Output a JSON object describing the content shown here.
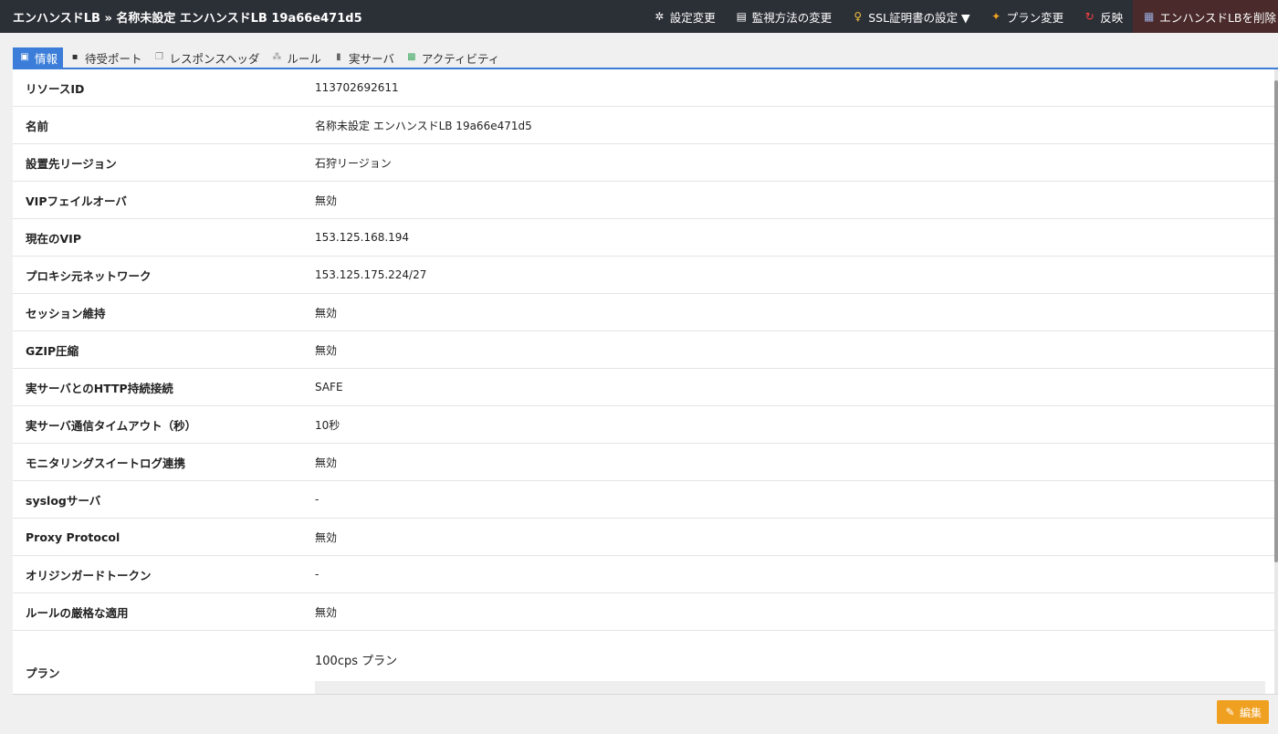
{
  "header": {
    "title": "エンハンスドLB » 名称未設定 エンハンスドLB 19a66e471d5",
    "actions": [
      {
        "label": "設定変更",
        "icon": "gear-icon"
      },
      {
        "label": "監視方法の変更",
        "icon": "monitor-icon"
      },
      {
        "label": "SSL証明書の設定 ▼",
        "icon": "key-icon"
      },
      {
        "label": "プラン変更",
        "icon": "plan-icon"
      },
      {
        "label": "反映",
        "icon": "refresh-icon"
      },
      {
        "label": "エンハンスドLBを削除",
        "icon": "delete-icon"
      }
    ]
  },
  "tabs": [
    {
      "label": "情報",
      "icon": "info-icon",
      "active": true
    },
    {
      "label": "待受ポート",
      "icon": "server-icon"
    },
    {
      "label": "レスポンスヘッダ",
      "icon": "window-icon"
    },
    {
      "label": "ルール",
      "icon": "rule-icon"
    },
    {
      "label": "実サーバ",
      "icon": "device-icon"
    },
    {
      "label": "アクティビティ",
      "icon": "activity-icon"
    }
  ],
  "rows": [
    {
      "label": "リソースID",
      "value": "113702692611"
    },
    {
      "label": "名前",
      "value": "名称未設定 エンハンスドLB 19a66e471d5"
    },
    {
      "label": "設置先リージョン",
      "value": "石狩リージョン"
    },
    {
      "label": "VIPフェイルオーバ",
      "value": "無効"
    },
    {
      "label": "現在のVIP",
      "value": "153.125.168.194"
    },
    {
      "label": "プロキシ元ネットワーク",
      "value": "153.125.175.224/27"
    },
    {
      "label": "セッション維持",
      "value": "無効"
    },
    {
      "label": "GZIP圧縮",
      "value": "無効"
    },
    {
      "label": "実サーバとのHTTP持続接続",
      "value": "SAFE"
    },
    {
      "label": "実サーバ通信タイムアウト（秒）",
      "value": "10秒"
    },
    {
      "label": "モニタリングスイートログ連携",
      "value": "無効"
    },
    {
      "label": "syslogサーバ",
      "value": "-"
    },
    {
      "label": "Proxy Protocol",
      "value": "無効"
    },
    {
      "label": "オリジンガードトークン",
      "value": "-"
    },
    {
      "label": "ルールの厳格な適用",
      "value": "無効"
    }
  ],
  "plan": {
    "label": "プラン",
    "value": "100cps プラン"
  },
  "footer": {
    "edit_label": "編集"
  },
  "colors": {
    "topbar": "#2b2f36",
    "tab_active": "#3b7dd8",
    "edit_button": "#f0a020"
  }
}
